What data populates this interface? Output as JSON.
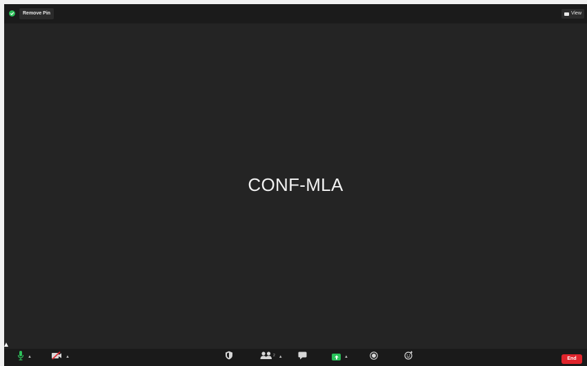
{
  "top_bar": {
    "remove_pin_label": "Remove Pin",
    "view_label": "View",
    "security_indicator_color": "#2dbf5a"
  },
  "video": {
    "participant_name": "CONF-MLA"
  },
  "toolbar": {
    "end_label": "End",
    "end_color": "#e0242c",
    "share_color": "#28c25a",
    "mic_color": "#2dbf5a",
    "items": [
      {
        "icon": "microphone-icon",
        "state": "unmuted"
      },
      {
        "icon": "video-off-icon",
        "state": "stopped"
      },
      {
        "icon": "security-shield-icon"
      },
      {
        "icon": "participants-icon",
        "count": "2"
      },
      {
        "icon": "chat-icon"
      },
      {
        "icon": "share-screen-icon",
        "state": "active"
      },
      {
        "icon": "record-icon"
      },
      {
        "icon": "reactions-icon"
      }
    ]
  }
}
